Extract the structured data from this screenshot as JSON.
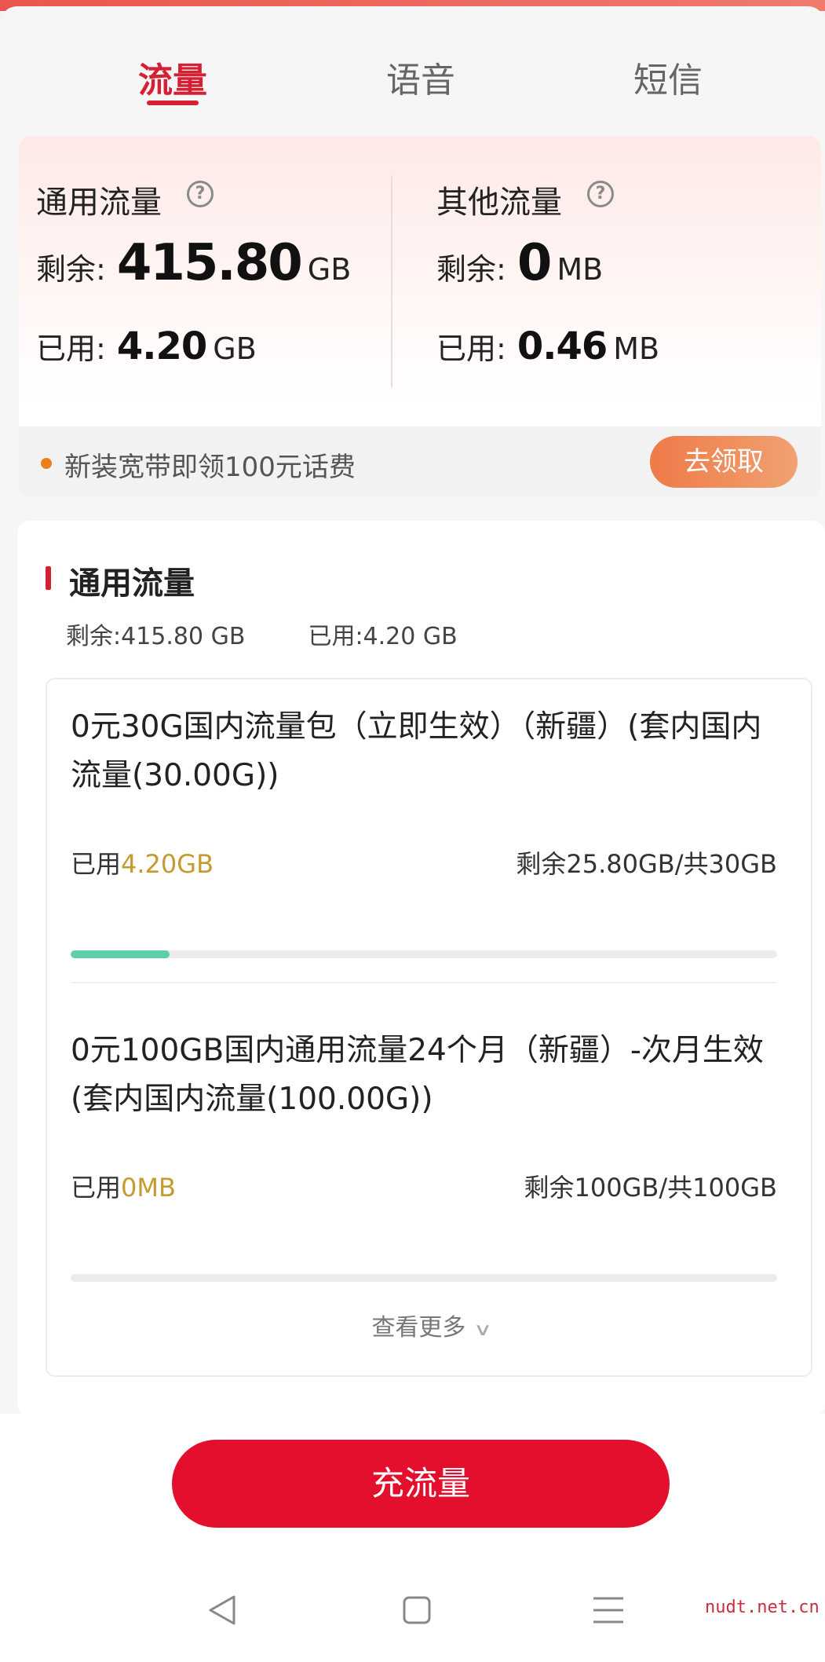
{
  "tabs": [
    {
      "label": "流量",
      "active": true
    },
    {
      "label": "语音",
      "active": false
    },
    {
      "label": "短信",
      "active": false
    }
  ],
  "summary": {
    "general": {
      "title": "通用流量",
      "remaining_label": "剩余:",
      "remaining_value": "415.80",
      "remaining_unit": "GB",
      "used_label": "已用:",
      "used_value": "4.20",
      "used_unit": "GB"
    },
    "other": {
      "title": "其他流量",
      "remaining_label": "剩余:",
      "remaining_value": "0",
      "remaining_unit": "MB",
      "used_label": "已用:",
      "used_value": "0.46",
      "used_unit": "MB"
    },
    "help_icon": "?"
  },
  "promo": {
    "text": "新装宽带即领100元话费",
    "button": "去领取"
  },
  "detail": {
    "section_title": "通用流量",
    "remaining": "剩余:415.80 GB",
    "used": "已用:4.20 GB",
    "packages": [
      {
        "name": "0元30G国内流量包（立即生效）（新疆）(套内国内流量(30.00G))",
        "used_label": "已用",
        "used_value": "4.20GB",
        "remaining": "剩余25.80GB/共30GB",
        "used_fraction": 0.14
      },
      {
        "name": "0元100GB国内通用流量24个月（新疆）-次月生效 (套内国内流量(100.00G))",
        "used_label": "已用",
        "used_value": "0MB",
        "remaining": "剩余100GB/共100GB",
        "used_fraction": 0
      }
    ],
    "more": "查看更多",
    "more_icon": "chevron-down-icon"
  },
  "recharge_button": "充流量",
  "nav": [
    "back-icon",
    "home-icon",
    "menu-icon"
  ],
  "watermark": "nudt.net.cn",
  "colors": {
    "accent_red": "#d51f33",
    "button_red": "#e30f2d",
    "progress_green": "#5fd0a5",
    "used_gold": "#c59a2e",
    "promo_orange": "#ee7a48"
  }
}
